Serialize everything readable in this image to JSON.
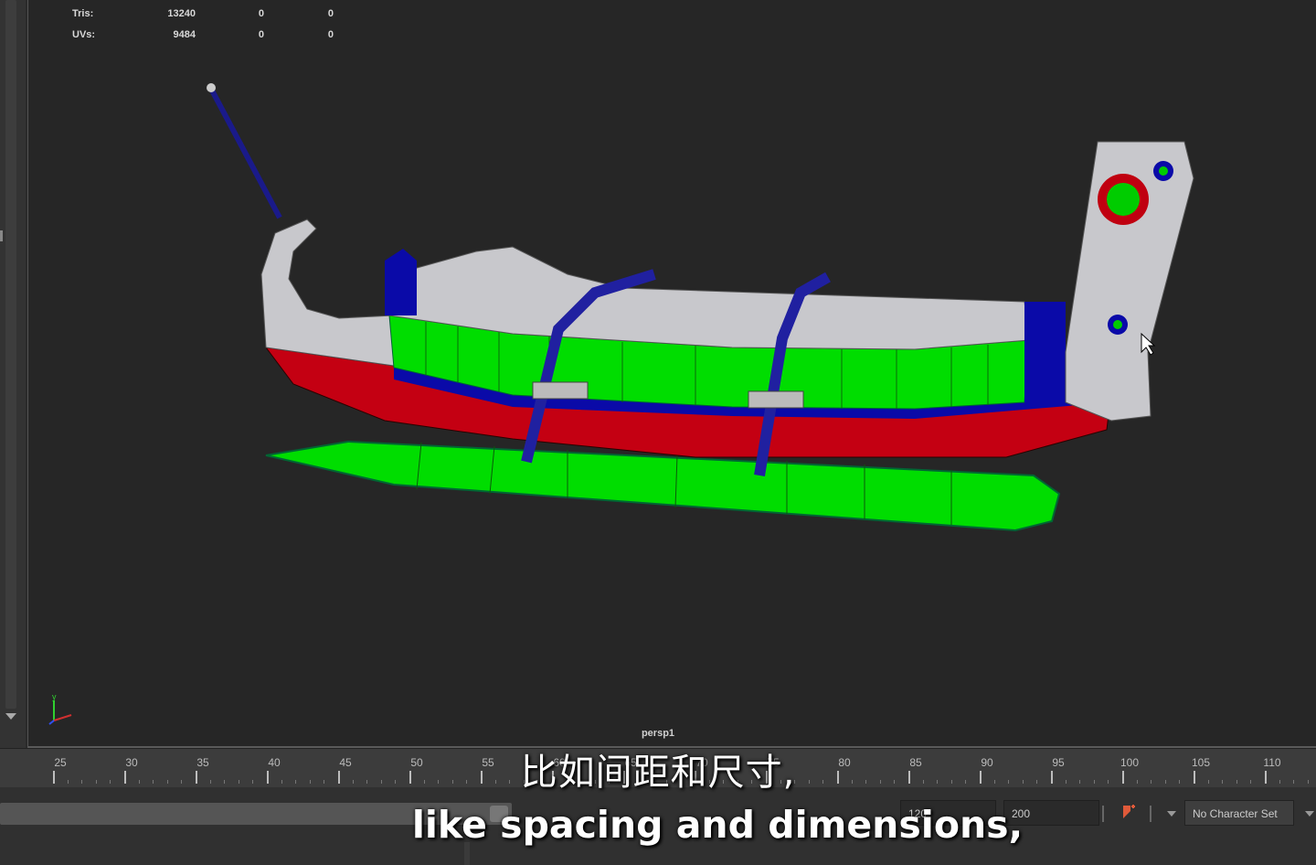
{
  "hud": {
    "rows": [
      {
        "label": "Tris:",
        "v1": "13240",
        "v2": "0",
        "v3": "0"
      },
      {
        "label": "UVs:",
        "v1": "9484",
        "v2": "0",
        "v3": "0"
      }
    ]
  },
  "viewport": {
    "camera_label": "persp1",
    "axis_y_label": "y"
  },
  "timeline": {
    "ticks": [
      "25",
      "30",
      "35",
      "40",
      "45",
      "50",
      "55",
      "60",
      "65",
      "70",
      "75",
      "80",
      "85",
      "90",
      "95",
      "100",
      "105",
      "110"
    ]
  },
  "range": {
    "start_value": "120",
    "end_value": "200",
    "character_set": "No Character Set"
  },
  "icons": {
    "key": "auto-key-icon",
    "dropdown": "chevron-down-icon"
  },
  "colors": {
    "green": "#00e000",
    "red": "#c00010",
    "blue": "#0a0aa8",
    "mesh": "#c8c8cc"
  },
  "subtitles": {
    "zh": "比如间距和尺寸,",
    "en": "like spacing and dimensions,"
  }
}
